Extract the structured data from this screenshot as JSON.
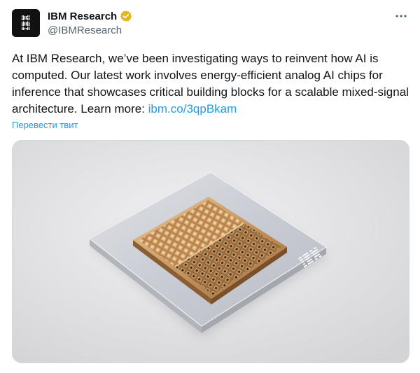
{
  "author": {
    "display_name": "IBM Research",
    "handle": "@IBMResearch",
    "avatar_icon": "ibm-logo-icon",
    "verified_icon": "verified-badge-icon",
    "verified_color": "#e2b719"
  },
  "tweet": {
    "text_before_link": "At IBM Research, we’ve been investigating ways to reinvent how AI is computed. Our latest work involves energy-efficient analog AI chips for inference that showcases critical building blocks for a scalable mixed-signal architecture. Learn more: ",
    "link_text": "ibm.co/3qpBkam",
    "translate_label": "Перевести твит",
    "link_color": "#1d9bf0"
  },
  "media": {
    "chip_logo_text": "IBM"
  },
  "menu": {
    "more_icon": "more-horizontal-icon"
  }
}
